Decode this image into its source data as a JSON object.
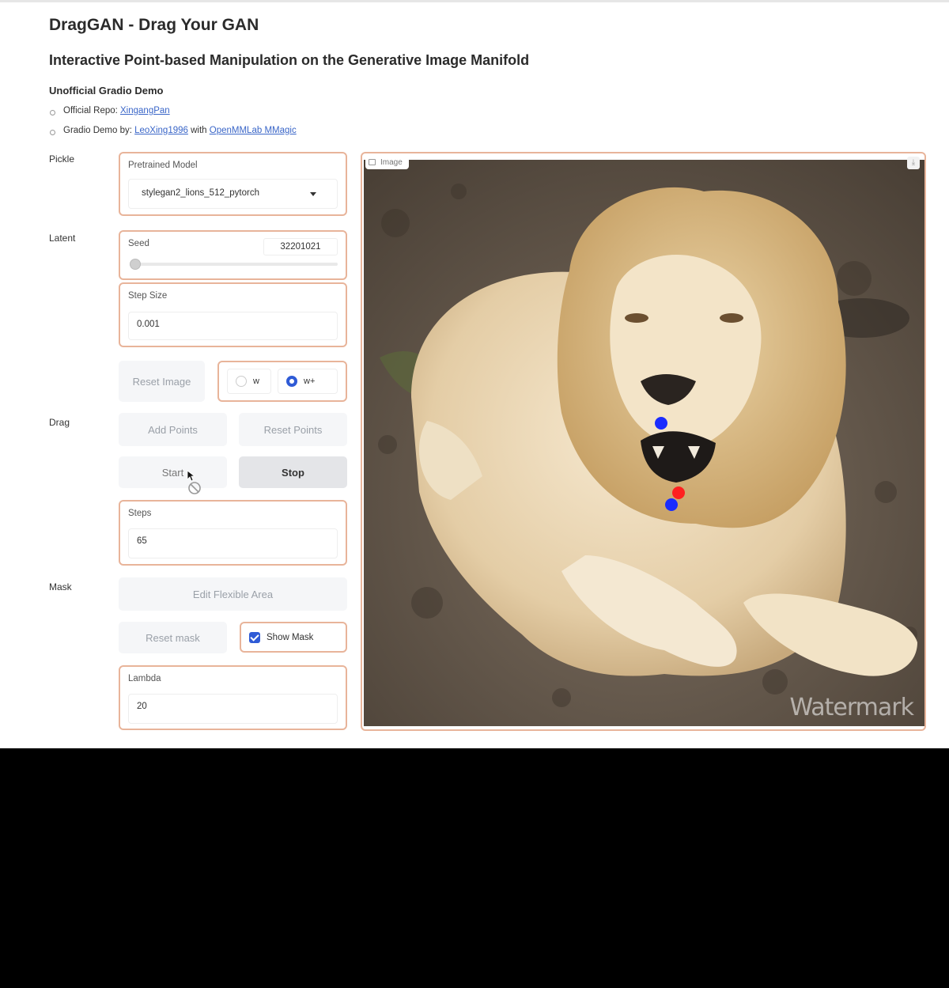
{
  "header": {
    "title": "DragGAN - Drag Your GAN",
    "subtitle": "Interactive Point-based Manipulation on the Generative Image Manifold",
    "section": "Unofficial Gradio Demo",
    "links": [
      {
        "prefix": "Official Repo: ",
        "link1": "XingangPan"
      },
      {
        "prefix": "Gradio Demo by: ",
        "link1": "LeoXing1996",
        "middle": " with ",
        "link2": "OpenMMLab MMagic"
      }
    ]
  },
  "labels": {
    "pickle": "Pickle",
    "latent": "Latent",
    "drag": "Drag",
    "mask": "Mask"
  },
  "pickle": {
    "label": "Pretrained Model",
    "value": "stylegan2_lions_512_pytorch"
  },
  "latent": {
    "seed_label": "Seed",
    "seed_value": "32201021",
    "seed_fraction": 0.0,
    "step_size_label": "Step Size",
    "step_size_value": "0.001",
    "reset_image": "Reset Image",
    "radio": {
      "w": "w",
      "wplus": "w+",
      "selected": "w+"
    }
  },
  "drag": {
    "add_points": "Add Points",
    "reset_points": "Reset Points",
    "start": "Start",
    "stop": "Stop",
    "steps_label": "Steps",
    "steps_value": "65"
  },
  "mask": {
    "edit_flexible_area": "Edit Flexible Area",
    "reset_mask": "Reset mask",
    "show_mask": "Show Mask",
    "show_mask_checked": true,
    "lambda_label": "Lambda",
    "lambda_value": "20"
  },
  "image": {
    "tag": "Image",
    "watermark": "Watermark"
  },
  "colors": {
    "accent_border": "#e8b49a",
    "handle_point": "#1a2cff",
    "target_point": "#ff2020",
    "selected_radio": "#2f5bd6"
  }
}
